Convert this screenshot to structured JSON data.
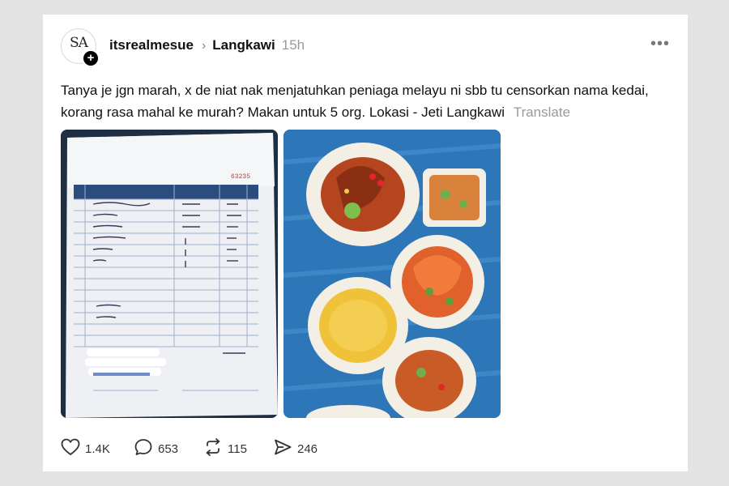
{
  "post": {
    "avatar_initials": "SA",
    "username": "itsrealmesue",
    "separator": "›",
    "community": "Langkawi",
    "time": "15h",
    "more_icon": "more-horizontal-icon",
    "text": "Tanya je jgn marah, x de niat nak menjatuhkan peniaga melayu ni sbb tu censorkan nama kedai, korang rasa mahal ke murah? Makan untuk 5 org. Lokasi - Jeti Langkawi",
    "translate_label": "Translate"
  },
  "actions": {
    "like_count": "1.4K",
    "comment_count": "653",
    "repost_count": "115",
    "share_count": "246"
  },
  "icons": {
    "like": "heart-icon",
    "comment": "speech-bubble-icon",
    "repost": "repost-icon",
    "share": "send-icon"
  },
  "colors": {
    "background": "#e3e3e3",
    "card": "#ffffff",
    "muted": "#9a9a9a",
    "receipt_header": "#2b4c7e",
    "tablecloth": "#2d77b8"
  }
}
